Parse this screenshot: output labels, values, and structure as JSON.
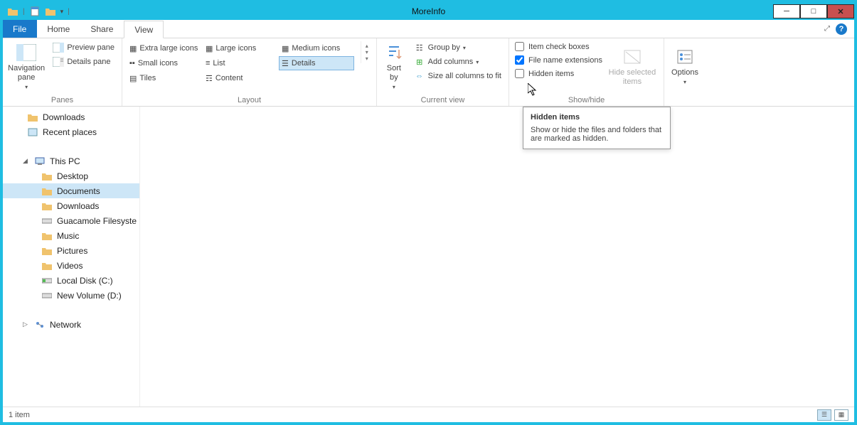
{
  "title": "MoreInfo",
  "tabs": {
    "file": "File",
    "home": "Home",
    "share": "Share",
    "view": "View"
  },
  "ribbon": {
    "panes": {
      "label": "Panes",
      "navigation": "Navigation\npane",
      "preview": "Preview pane",
      "details": "Details pane"
    },
    "layout": {
      "label": "Layout",
      "xlarge": "Extra large icons",
      "large": "Large icons",
      "medium": "Medium icons",
      "small": "Small icons",
      "list": "List",
      "details": "Details",
      "tiles": "Tiles",
      "content": "Content"
    },
    "currentview": {
      "label": "Current view",
      "sortby": "Sort\nby",
      "groupby": "Group by",
      "addcols": "Add columns",
      "sizecols": "Size all columns to fit"
    },
    "showhide": {
      "label": "Show/hide",
      "itemcheck": "Item check boxes",
      "fileext": "File name extensions",
      "hidden": "Hidden items",
      "hidesel": "Hide selected\nitems"
    },
    "options": "Options"
  },
  "tooltip": {
    "title": "Hidden items",
    "body": "Show or hide the files and folders that are marked as hidden."
  },
  "tree": {
    "downloads": "Downloads",
    "recent": "Recent places",
    "thispc": "This PC",
    "desktop": "Desktop",
    "documents": "Documents",
    "downloads2": "Downloads",
    "guac": "Guacamole Filesyste",
    "music": "Music",
    "pictures": "Pictures",
    "videos": "Videos",
    "localc": "Local Disk (C:)",
    "newvol": "New Volume (D:)",
    "network": "Network"
  },
  "status": {
    "items": "1 item"
  },
  "checks": {
    "itemcheck": false,
    "fileext": true,
    "hidden": false
  }
}
